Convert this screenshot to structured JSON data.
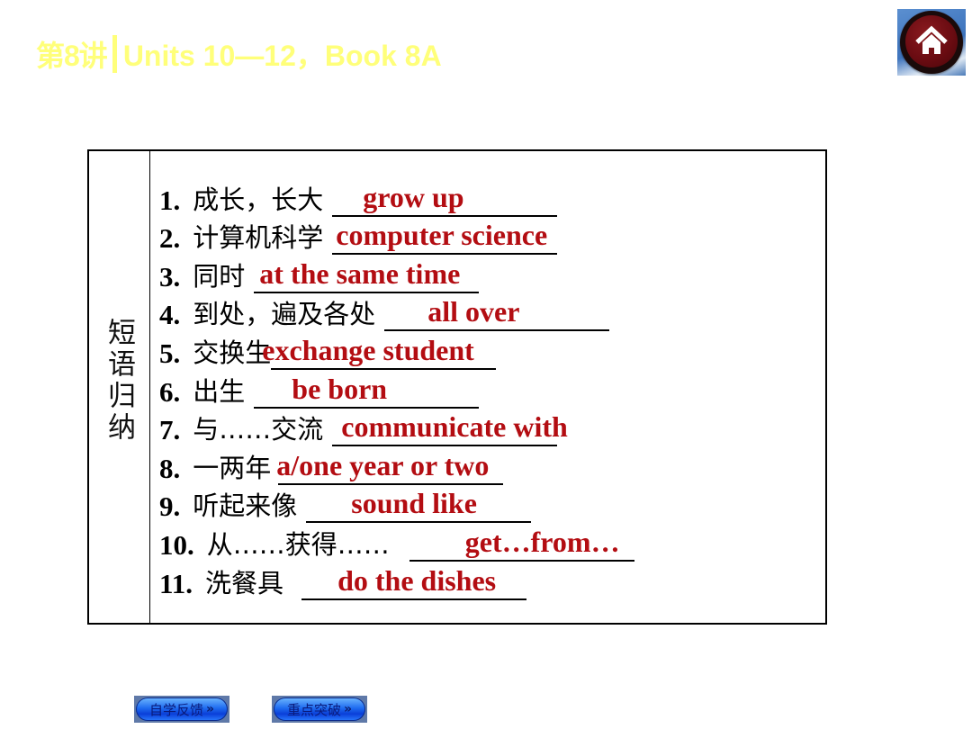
{
  "header": {
    "lecture": "第8讲",
    "title": "Units 10—12，Book 8A",
    "title_color": "#ffff7a"
  },
  "home_button": {
    "icon": "home-icon",
    "label": "Home"
  },
  "table": {
    "side_label": "短语归纳",
    "answer_color": "#b30d12",
    "items": [
      {
        "num": "1.",
        "cn": "成长，长大",
        "answer": "grow up"
      },
      {
        "num": "2.",
        "cn": "计算机科学",
        "answer": "computer science"
      },
      {
        "num": "3.",
        "cn": "同时",
        "answer": "at the same time"
      },
      {
        "num": "4.",
        "cn": "到处，遍及各处",
        "answer": "all over"
      },
      {
        "num": "5.",
        "cn": "交换生",
        "answer": "exchange student"
      },
      {
        "num": "6.",
        "cn": "出生",
        "answer": "be born"
      },
      {
        "num": "7.",
        "cn": "与……交流",
        "answer": "communicate with"
      },
      {
        "num": "8.",
        "cn": "一两年",
        "answer": "a/one year or two"
      },
      {
        "num": "9.",
        "cn": "听起来像",
        "answer": "sound like"
      },
      {
        "num": "10.",
        "cn": "从……获得……",
        "answer": "get…from…"
      },
      {
        "num": "11.",
        "cn": "洗餐具",
        "answer": "do the dishes"
      }
    ]
  },
  "nav": {
    "self_study_feedback": "自学反馈",
    "key_breakthrough": "重点突破",
    "chevron": "»"
  }
}
